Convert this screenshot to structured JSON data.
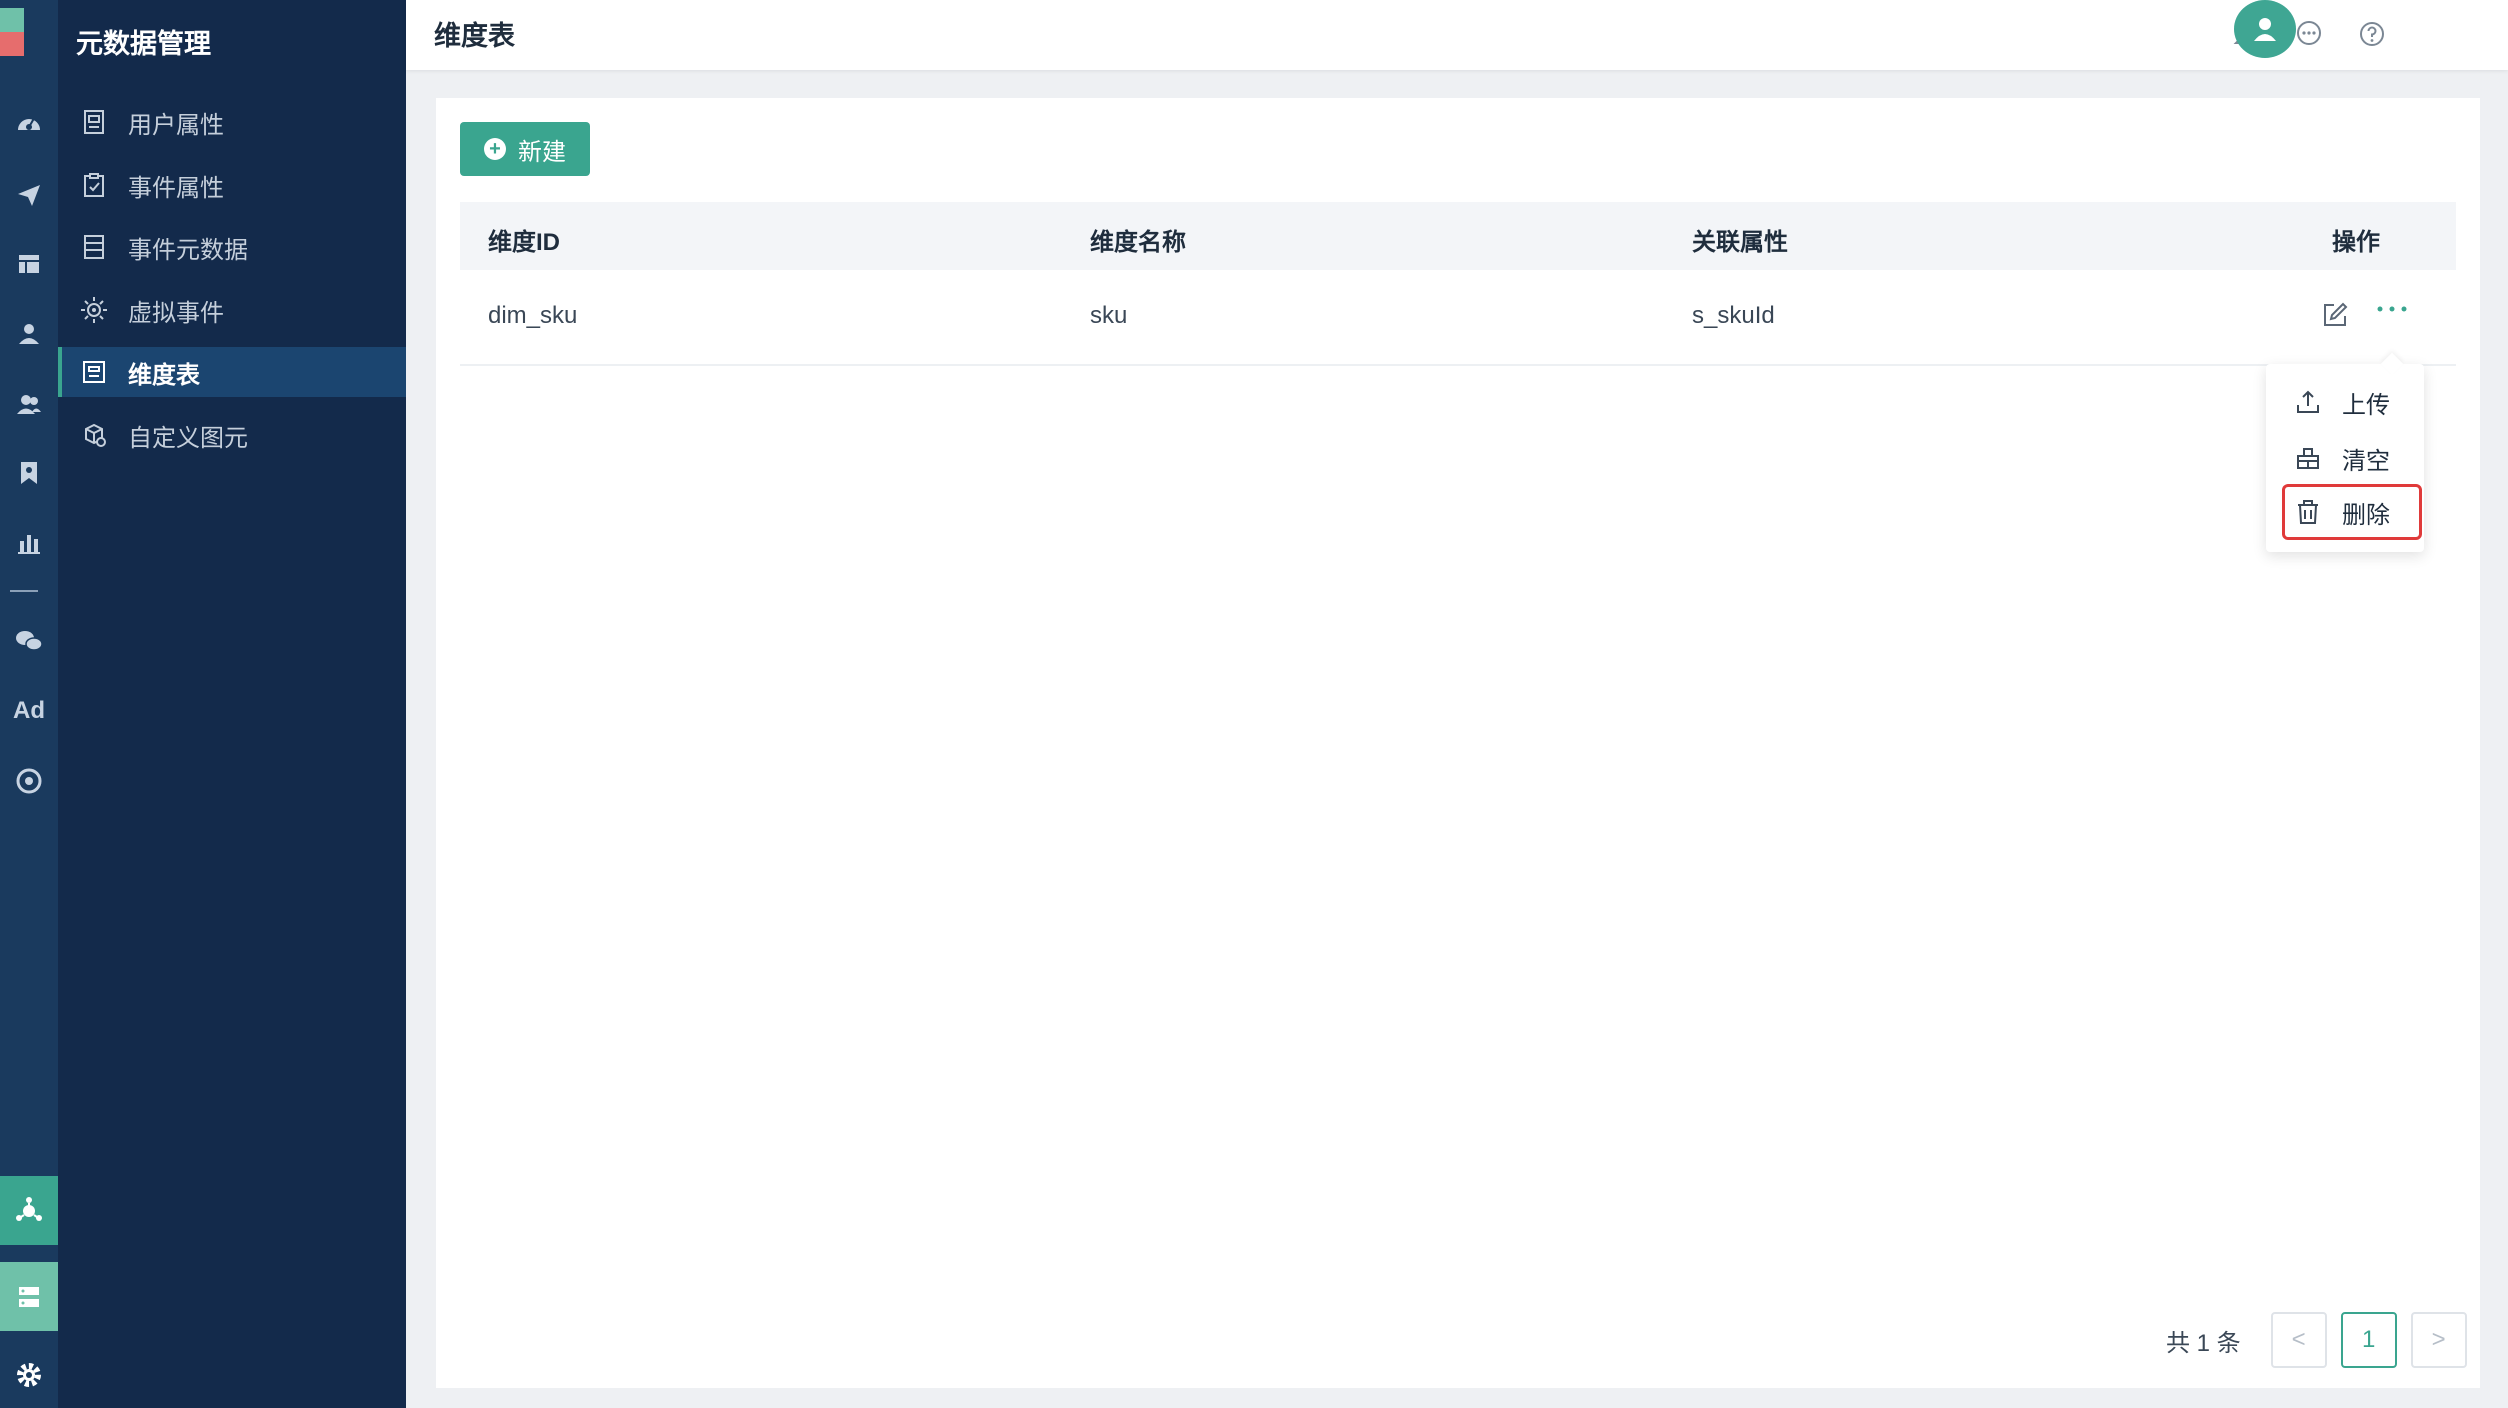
{
  "app": {
    "section_title": "元数据管理"
  },
  "rail": {
    "icons": [
      "dashboard-icon",
      "send-icon",
      "table-icon",
      "user-icon",
      "users-icon",
      "bookmark-icon",
      "bar-chart-icon",
      "wechat-icon",
      "ad-icon",
      "target-icon"
    ],
    "ad_label": "Ad",
    "bottom_icons": [
      "node-icon",
      "server-icon",
      "settings-icon"
    ]
  },
  "sidebar": {
    "items": [
      {
        "label": "用户属性",
        "icon": "document-icon"
      },
      {
        "label": "事件属性",
        "icon": "clipboard-icon"
      },
      {
        "label": "事件元数据",
        "icon": "list-icon"
      },
      {
        "label": "虚拟事件",
        "icon": "sun-icon"
      },
      {
        "label": "维度表",
        "icon": "dimension-table-icon",
        "active": true
      },
      {
        "label": "自定义图元",
        "icon": "cube-icon"
      }
    ]
  },
  "header": {
    "title": "维度表",
    "icons": [
      "bell-icon",
      "message-icon",
      "help-icon"
    ]
  },
  "toolbar": {
    "new_label": "新建",
    "new_icon": "+"
  },
  "table": {
    "columns": [
      "维度ID",
      "维度名称",
      "关联属性",
      "操作"
    ],
    "rows": [
      {
        "id": "dim_sku",
        "name": "sku",
        "attr": "s_skuId"
      }
    ]
  },
  "dropdown": {
    "items": [
      {
        "label": "上传",
        "icon": "upload-icon"
      },
      {
        "label": "清空",
        "icon": "clear-icon"
      },
      {
        "label": "删除",
        "icon": "trash-icon"
      }
    ]
  },
  "pagination": {
    "total": "共 1 条",
    "current_page": "1",
    "prev": "<",
    "next": ">"
  },
  "colors": {
    "accent": "#3aa58f",
    "sidebar_bg": "#132a4b",
    "rail_bg": "#1a3a5e",
    "highlight": "#e03a3a"
  }
}
